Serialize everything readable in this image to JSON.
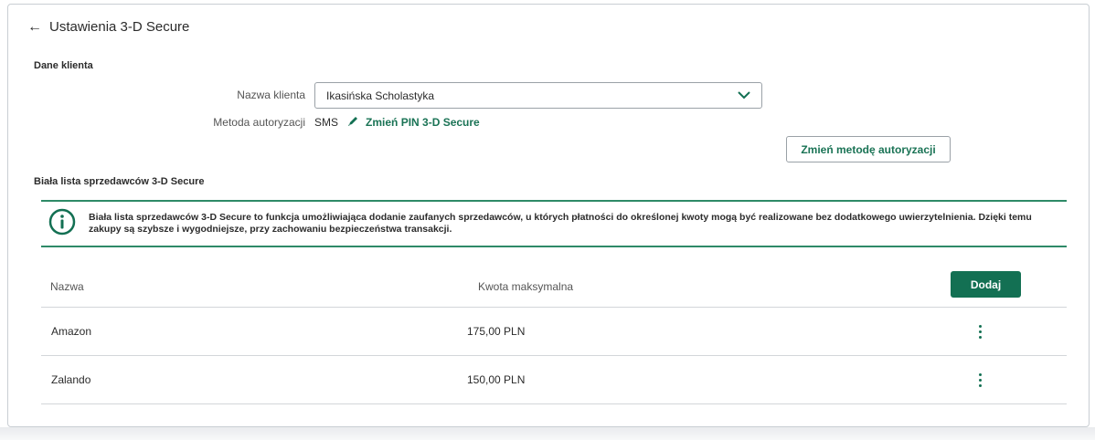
{
  "header": {
    "back_arrow": "←",
    "title": "Ustawienia 3-D Secure"
  },
  "client_section": {
    "title": "Dane klienta",
    "name_label": "Nazwa klienta",
    "name_value": "Ikasińska Scholastyka",
    "method_label": "Metoda autoryzacji",
    "method_value": "SMS",
    "change_pin_label": "Zmień PIN 3-D Secure",
    "change_method_button": "Zmień metodę autoryzacji"
  },
  "whitelist": {
    "title": "Biała lista sprzedawców 3-D Secure",
    "info_text": "Biała lista sprzedawców 3-D Secure to funkcja umożliwiająca dodanie zaufanych sprzedawców, u których płatności do określonej kwoty mogą być realizowane bez dodatkowego uwierzytelnienia. Dzięki temu zakupy są szybsze i wygodniejsze, przy zachowaniu bezpieczeństwa transakcji.",
    "columns": [
      "Nazwa",
      "Kwota maksymalna"
    ],
    "add_button": "Dodaj",
    "rows": [
      {
        "name": "Amazon",
        "amount": "175,00 PLN"
      },
      {
        "name": "Zalando",
        "amount": "150,00 PLN"
      }
    ]
  },
  "colors": {
    "accent": "#137053",
    "link": "#1a7355",
    "info_border": "#2e8a67"
  },
  "icons": [
    "back-arrow-icon",
    "chevron-down-icon",
    "pencil-icon",
    "info-icon",
    "kebab-menu-icon"
  ]
}
